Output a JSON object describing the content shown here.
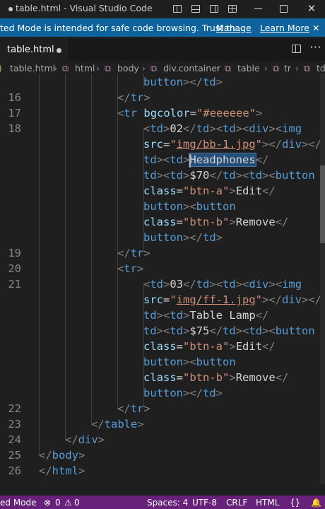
{
  "window": {
    "title": "table.html - Visual Studio Code",
    "controls": [
      "toggle-primary-sidebar",
      "toggle-panel",
      "toggle-secondary-sidebar",
      "customize-layout",
      "minimize",
      "maximize",
      "close"
    ]
  },
  "banner": {
    "message": "ted Mode is intended for safe code browsing. Trust th...",
    "manage_label": "Manage",
    "learn_more_label": "Learn More",
    "close_label": "✕"
  },
  "tab": {
    "label": "table.html"
  },
  "breadcrumb": [
    "table.html",
    "html",
    "body",
    "div.container",
    "table",
    "tr",
    "td"
  ],
  "editor": {
    "line_numbers": [
      "16",
      "17",
      "18",
      "19",
      "20",
      "21",
      "22",
      "23",
      "24",
      "25",
      "26"
    ],
    "selected_text": "Headphones"
  },
  "status": {
    "mode": "ed Mode",
    "errors": "0",
    "warnings": "0",
    "spaces": "Spaces: 4",
    "encoding": "UTF-8",
    "eol": "CRLF",
    "language": "HTML"
  },
  "colors": {
    "banner_bg": "#0e639c",
    "status_bg": "#68217a",
    "tag": "#569cd6",
    "attr": "#9cdcfe",
    "string": "#ce9178"
  }
}
